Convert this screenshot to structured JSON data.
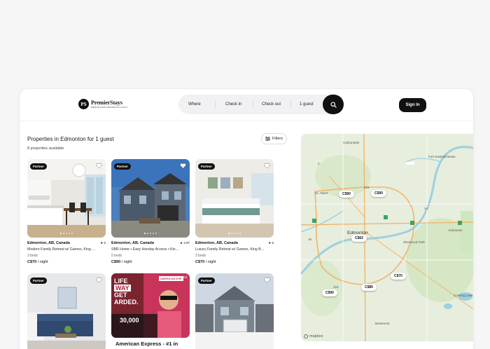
{
  "brand": {
    "name": "PremierStays",
    "mark": "PS",
    "tagline": "PREMIUM SHORT-TERM RENTALS & STAYS"
  },
  "search": {
    "where": "Where",
    "check_in": "Check in",
    "check_out": "Check out",
    "guests": "1 guest"
  },
  "header": {
    "sign_in": "Sign In"
  },
  "results": {
    "title": "Properties in Edmonton for 1 guest",
    "count": "8 properties available",
    "filters": "Filters"
  },
  "cards": [
    {
      "badge": "Partner",
      "location": "Edmonton, AB, Canada",
      "rating": "5",
      "name": "Modern Family Retreat w/ Games, King ...",
      "beds": "3 beds",
      "price": "C$70",
      "per": "/ night"
    },
    {
      "badge": "Partner",
      "location": "Edmonton, AB, Canada",
      "rating": "4.87",
      "name": "SBR Home • Easy Henday Access • Kin...",
      "beds": "5 beds",
      "price": "C$90",
      "per": "/ night"
    },
    {
      "badge": "Partner",
      "location": "Edmonton, AB, Canada",
      "rating": "5",
      "name": "Luxury Family Retreat w/ Games, King B...",
      "beds": "3 beds",
      "price": "C$70",
      "per": "/ night"
    },
    {
      "badge": "Partner"
    },
    {
      "ad_title": "American Express - #1 in",
      "ad_line1": "LIFE",
      "ad_line2": "WAY",
      "ad_line3": "GET",
      "ad_line4": "ARDED.",
      "ad_amount": "30,000",
      "ad_brand": "AMERICAN EXP",
      "ad_tag": "Ad"
    },
    {
      "badge": "Partner"
    }
  ],
  "map": {
    "places": [
      "Carbondale",
      "Fort Saskatchewan",
      "St. Albert",
      "Edmonton",
      "Ardrossan",
      "Sherwood Park",
      "Beaumont",
      "Cooking Lake"
    ],
    "roads": [
      "2",
      "216",
      "14",
      "16",
      "216"
    ],
    "pins": [
      "C$90",
      "C$90",
      "C$62",
      "C$70",
      "C$85",
      "C$90"
    ],
    "attribution": "mapbox"
  },
  "colors": {
    "accent": "#111111",
    "map_water": "#9cd0e0",
    "map_park": "#cfe7c0",
    "map_highway": "#f2b46b"
  }
}
